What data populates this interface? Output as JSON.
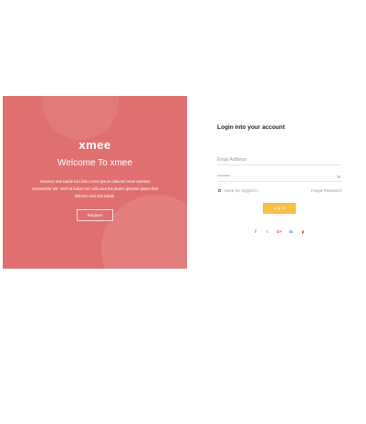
{
  "promo": {
    "brand": "xmee",
    "welcome": "Welcome To xmee",
    "description": "Geamus mal easde faci lisis Lorem ipsum dolarorit more ametion consectetur elit. Vesti at bulum nec odio aea the dumm ipsumm ipsum that dolorem mal mal easde.",
    "register_label": "Register"
  },
  "form": {
    "title": "Login into your account",
    "email_placeholder": "Email Address",
    "password_value": "••••••••",
    "keep_logged_in": "Keep me logged in",
    "forgot_password": "Forgot Password",
    "login_label": "Log In"
  },
  "social": [
    {
      "icon": "facebook-icon",
      "glyph": "f",
      "color": "#3b5998"
    },
    {
      "icon": "twitter-icon",
      "glyph": "t",
      "color": "#1da1f2"
    },
    {
      "icon": "google-plus-icon",
      "glyph": "G+",
      "color": "#dd4b39"
    },
    {
      "icon": "linkedin-icon",
      "glyph": "in",
      "color": "#0077b5"
    },
    {
      "icon": "pinterest-icon",
      "glyph": "p",
      "color": "#cb2027"
    }
  ],
  "colors": {
    "promo_bg": "#e07070",
    "accent": "#f6c043"
  }
}
